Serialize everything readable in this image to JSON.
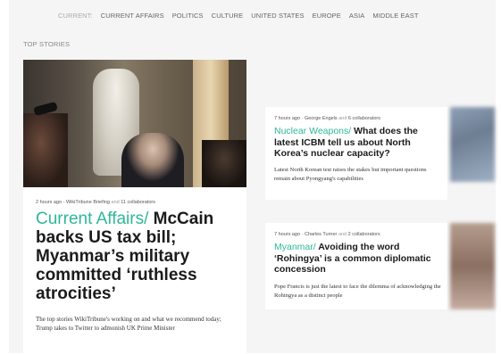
{
  "nav": {
    "current_label": "CURRENT:",
    "items": [
      "CURRENT AFFAIRS",
      "POLITICS",
      "CULTURE",
      "UNITED STATES",
      "EUROPE",
      "ASIA",
      "MIDDLE EAST"
    ]
  },
  "section_label": "TOP STORIES",
  "main_story": {
    "meta_time": "2 hours ago",
    "meta_dot": "·",
    "meta_author": "WikiTribune Briefing",
    "meta_and": "and",
    "meta_collab": "11 collaborators",
    "category": "Current Affairs",
    "separator": "/",
    "title": "McCain backs US tax bill; Myanmar’s military committed ‘ruthless atrocities’",
    "summary": "The top stories WikiTribune's working on and what we recommend today; Trump takes to Twitter to admonish UK Prime Minister"
  },
  "side_stories": [
    {
      "meta_time": "7 hours ago",
      "meta_dot": "·",
      "meta_author": "George Engels",
      "meta_and": "and",
      "meta_collab": "6 collaborators",
      "category": "Nuclear Weapons",
      "separator": "/",
      "title": "What does the latest ICBM tell us about North Korea’s nuclear capacity?",
      "summary": "Latest North Korean test raises the stakes but important questions remain about Pyongyang's capabilities"
    },
    {
      "meta_time": "7 hours ago",
      "meta_dot": "·",
      "meta_author": "Charles Turner",
      "meta_and": "and",
      "meta_collab": "2 collaborators",
      "category": "Myanmar",
      "separator": "/",
      "title": "Avoiding the word ‘Rohingya’ is a common diplomatic concession",
      "summary": "Pope Francis is just the latest to face the dilemma of acknowledging the Rohingya as a distinct people"
    }
  ],
  "colors": {
    "accent": "#2fb79a",
    "background": "#f5f5f5",
    "card": "#ffffff"
  }
}
